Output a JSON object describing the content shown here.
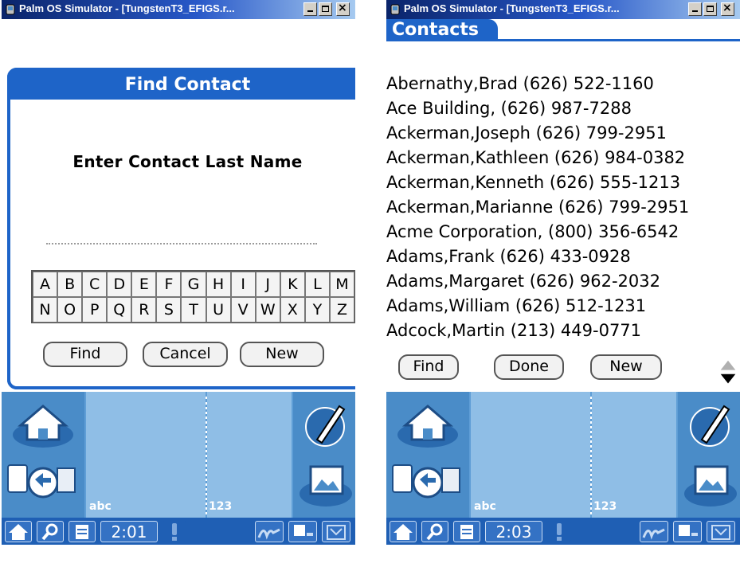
{
  "left_window": {
    "title": "Palm OS Simulator - [TungstenT3_EFIGS.r...",
    "dialog": {
      "title": "Find Contact",
      "prompt": "Enter Contact Last Name",
      "name_value": "",
      "keys_row1": [
        "A",
        "B",
        "C",
        "D",
        "E",
        "F",
        "G",
        "H",
        "I",
        "J",
        "K",
        "L",
        "M"
      ],
      "keys_row2": [
        "N",
        "O",
        "P",
        "Q",
        "R",
        "S",
        "T",
        "U",
        "V",
        "W",
        "X",
        "Y",
        "Z"
      ],
      "find_label": "Find",
      "cancel_label": "Cancel",
      "new_label": "New"
    },
    "graffiti_abc": "abc",
    "graffiti_123": "123",
    "time": "2:01"
  },
  "right_window": {
    "title": "Palm OS Simulator - [TungstenT3_EFIGS.r...",
    "tab_title": "Contacts",
    "contacts": [
      "Abernathy,Brad (626) 522-1160",
      "Ace Building, (626) 987-7288",
      "Ackerman,Joseph (626) 799-2951",
      "Ackerman,Kathleen (626) 984-0382",
      "Ackerman,Kenneth (626) 555-1213",
      "Ackerman,Marianne (626) 799-2951",
      "Acme Corporation, (800) 356-6542",
      "Adams,Frank (626) 433-0928",
      "Adams,Margaret (626) 962-2032",
      "Adams,William (626) 512-1231",
      "Adcock,Martin (213) 449-0771"
    ],
    "find_label": "Find",
    "done_label": "Done",
    "new_label": "New",
    "graffiti_abc": "abc",
    "graffiti_123": "123",
    "time": "2:03"
  },
  "colors": {
    "palm_blue": "#1e64c8",
    "graffiti_blue": "#5f9ed6",
    "status_blue": "#1f5fb4"
  },
  "icons": [
    "palm-app-icon",
    "minimize-icon",
    "maximize-icon",
    "close-icon",
    "home-icon",
    "hotsync-icon",
    "pen-icon",
    "screen-image-icon",
    "home-small-icon",
    "find-icon",
    "menu-icon",
    "alert-icon",
    "graffiti-icon",
    "keyboard-icon",
    "download-icon",
    "scroll-arrows-icon"
  ]
}
